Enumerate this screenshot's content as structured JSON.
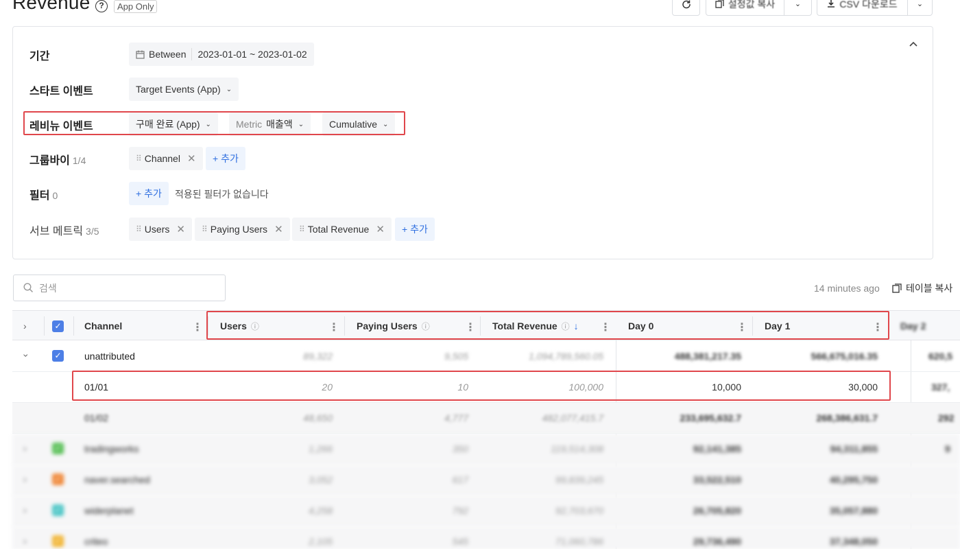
{
  "header": {
    "title": "Revenue",
    "badge": "App Only",
    "copy_settings_label": "설정값 복사",
    "csv_label": "CSV 다운로드"
  },
  "settings": {
    "period": {
      "label": "기간",
      "mode": "Between",
      "range": "2023-01-01 ~ 2023-01-02"
    },
    "start_event": {
      "label": "스타트 이벤트",
      "value": "Target Events (App)"
    },
    "revenue_event": {
      "label": "레비뉴 이벤트",
      "event": "구매 완료 (App)",
      "metric_label": "Metric",
      "metric_value": "매출액",
      "mode": "Cumulative"
    },
    "group_by": {
      "label": "그룹바이",
      "count": "1/4",
      "chips": [
        "Channel"
      ],
      "add_label": "+ 추가"
    },
    "filter": {
      "label": "필터",
      "count": "0",
      "add_label": "+ 추가",
      "empty_text": "적용된 필터가 없습니다"
    },
    "sub_metrics": {
      "label": "서브 메트릭",
      "count": "3/5",
      "chips": [
        "Users",
        "Paying Users",
        "Total Revenue"
      ],
      "add_label": "+ 추가"
    }
  },
  "toolbar": {
    "search_placeholder": "검색",
    "updated": "14 minutes ago",
    "copy_table_label": "테이블 복사"
  },
  "table": {
    "columns": [
      "Channel",
      "Users",
      "Paying Users",
      "Total Revenue",
      "Day 0",
      "Day 1",
      "Day 2"
    ],
    "rows": [
      {
        "channel": "unattributed",
        "users": "89,322",
        "paying": "9,505",
        "total": "1,094,789,560.05",
        "day0": "488,381,217.35",
        "day1": "566,675,016.35",
        "day2": "620,5",
        "color": "#4d7fe6",
        "expanded": true
      },
      {
        "channel": "01/01",
        "users": "20",
        "paying": "10",
        "total": "100,000",
        "day0": "10,000",
        "day1": "30,000",
        "day2": "327,",
        "sub": true
      },
      {
        "channel": "01/02",
        "users": "48,650",
        "paying": "4,777",
        "total": "482,077,415.7",
        "day0": "233,695,632.7",
        "day1": "268,386,631.7",
        "day2": "292",
        "sub": true,
        "blurred": true
      },
      {
        "channel": "tradingworks",
        "users": "1,266",
        "paying": "350",
        "total": "119,514,308",
        "day0": "92,141,385",
        "day1": "94,311,855",
        "day2": "9",
        "color": "#5cc15a",
        "blurred": true
      },
      {
        "channel": "naver.searched",
        "users": "3,052",
        "paying": "617",
        "total": "99,839,245",
        "day0": "33,522,510",
        "day1": "40,295,750",
        "day2": "",
        "color": "#f08a3c",
        "blurred": true
      },
      {
        "channel": "widerplanet",
        "users": "4,258",
        "paying": "792",
        "total": "92,703,670",
        "day0": "26,705,820",
        "day1": "35,057,880",
        "day2": "",
        "color": "#4fc7c7",
        "blurred": true
      },
      {
        "channel": "criteo",
        "users": "2,105",
        "paying": "545",
        "total": "71,060,786",
        "day0": "29,736,490",
        "day1": "37,348,050",
        "day2": "",
        "color": "#f2b73a",
        "blurred": true
      }
    ]
  }
}
